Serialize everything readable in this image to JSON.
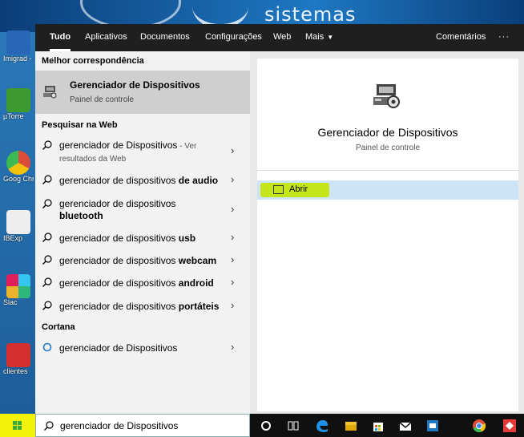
{
  "desktop": {
    "banner_text": "sistemas",
    "icons": [
      {
        "label": "Imigrad - Atal",
        "color": "#2a66b8"
      },
      {
        "label": "µTorre",
        "color": "#3e9a2f"
      },
      {
        "label": "Goog Chrom",
        "color": "#dd4b39"
      },
      {
        "label": "IBExp",
        "color": "#4caf50"
      },
      {
        "label": "Slac",
        "color": "#611f69"
      },
      {
        "label": "clientes",
        "color": "#d32f2f"
      }
    ]
  },
  "tabs": [
    {
      "label": "Tudo",
      "active": true
    },
    {
      "label": "Aplicativos"
    },
    {
      "label": "Documentos"
    },
    {
      "label": "Configurações"
    },
    {
      "label": "Web"
    },
    {
      "label": "Mais"
    }
  ],
  "feedback_label": "Comentários",
  "more_options": "···",
  "sections": {
    "best_match": "Melhor correspondência",
    "web_search": "Pesquisar na Web",
    "cortana": "Cortana"
  },
  "best_match": {
    "title": "Gerenciador de Dispositivos",
    "subtitle": "Painel de controle"
  },
  "web_results": [
    {
      "prefix": "gerenciador de Dispositivos",
      "bold": "",
      "suffix": " - Ver",
      "sub": "resultados da Web"
    },
    {
      "prefix": "gerenciador de dispositivos ",
      "bold": "de audio"
    },
    {
      "prefix": "gerenciador de dispositivos",
      "bold": "bluetooth"
    },
    {
      "prefix": "gerenciador de dispositivos ",
      "bold": "usb"
    },
    {
      "prefix": "gerenciador de dispositivos ",
      "bold": "webcam"
    },
    {
      "prefix": "gerenciador de dispositivos ",
      "bold": "android"
    },
    {
      "prefix": "gerenciador de dispositivos ",
      "bold": "portáteis"
    }
  ],
  "cortana_result": "gerenciador de Dispositivos",
  "preview": {
    "title": "Gerenciador de Dispositivos",
    "subtitle": "Painel de controle",
    "action_label": "Abrir",
    "highlight_color": "#c5e51b"
  },
  "taskbar": {
    "search_value": "gerenciador de Dispositivos"
  },
  "chevron": "›"
}
